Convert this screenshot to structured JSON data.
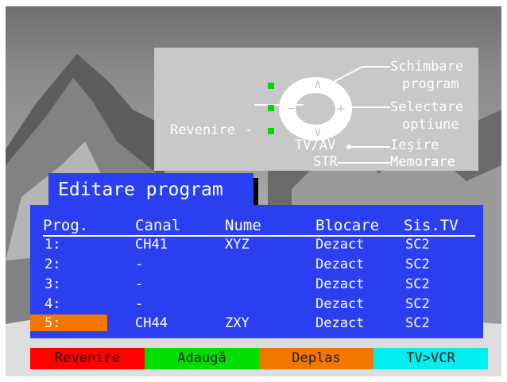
{
  "help": {
    "schimbare_1": "Schimbare",
    "schimbare_2": "program",
    "selectare_1": "Selectare",
    "selectare_2": "optiune",
    "iesire": "Ieşire",
    "memorare": "Memorare",
    "revenire": "Revenire",
    "tvav": "TV/AV",
    "str": "STR",
    "up_symbol": "∧",
    "down_symbol": "∨",
    "minus_symbol": "−",
    "plus_symbol": "+"
  },
  "title": "Editare program",
  "table": {
    "headers": [
      "Prog.",
      "Canal",
      "Nume",
      "Blocare",
      "Sis.TV"
    ],
    "rows": [
      {
        "prog": "1:",
        "canal": "CH41",
        "nume": "XYZ",
        "blocare": "Dezact",
        "sistv": "SC2"
      },
      {
        "prog": "2:",
        "canal": "-",
        "nume": "",
        "blocare": "Dezact",
        "sistv": "SC2"
      },
      {
        "prog": "3:",
        "canal": "-",
        "nume": "",
        "blocare": "Dezact",
        "sistv": "SC2"
      },
      {
        "prog": "4:",
        "canal": "-",
        "nume": "",
        "blocare": "Dezact",
        "sistv": "SC2"
      },
      {
        "prog": "5:",
        "canal": "CH44",
        "nume": "ZXY",
        "blocare": "Dezact",
        "sistv": "SC2"
      }
    ],
    "selected_row": 5
  },
  "buttons": {
    "red": "Revenire",
    "green": "Adaugă",
    "orange": "Deplas",
    "cyan": "TV>VCR"
  },
  "colors": {
    "menu_blue": "#2a3ff0",
    "red": "#ff0000",
    "green": "#00e000",
    "orange": "#f07800",
    "cyan": "#00f0f0",
    "led_green": "#00d800",
    "panel_gray": "#c8c8c8"
  }
}
